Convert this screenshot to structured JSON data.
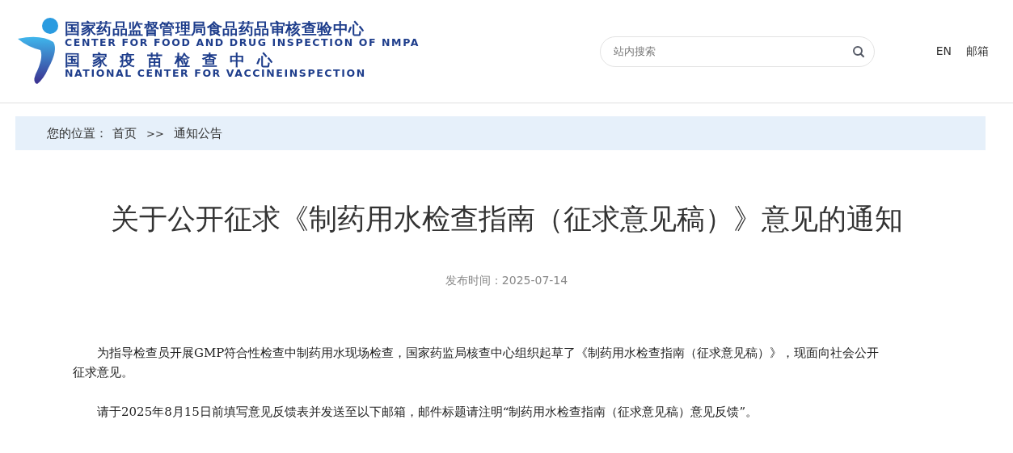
{
  "header": {
    "logo": {
      "title_cn": "国家药品监督管理局食品药品审核查验中心",
      "title_en": "CENTER FOR FOOD AND DRUG INSPECTION OF NMPA",
      "subtitle_cn": "国家疫苗检查中心",
      "subtitle_en": "NATIONAL CENTER FOR VACCINEINSPECTION"
    },
    "search": {
      "placeholder": "站内搜索"
    },
    "links": [
      "EN",
      "邮箱"
    ]
  },
  "breadcrumb": {
    "label": "您的位置：",
    "items": [
      "首页",
      "通知公告"
    ],
    "separator": ">>"
  },
  "article": {
    "title": "关于公开征求《制药用水检查指南（征求意见稿）》意见的通知",
    "date": "发布时间：2025-07-14",
    "paragraphs": [
      "为指导检查员开展GMP符合性检查中制药用水现场检查，国家药监局核查中心组织起草了《制药用水检查指南（征求意见稿）》，现面向社会公开征求意见。",
      "请于2025年8月15日前填写意见反馈表并发送至以下邮箱，邮件标题请注明“制药用水检查指南（征求意见稿）意见反馈”。"
    ]
  }
}
